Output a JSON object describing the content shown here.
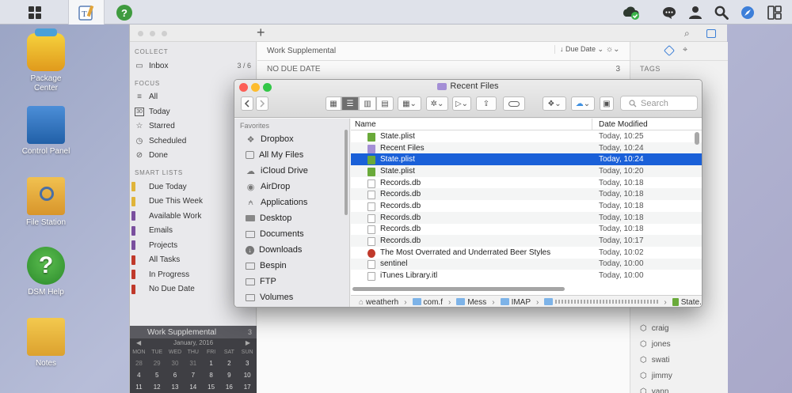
{
  "topbar": {
    "apps": [
      "grid-icon",
      "text-editor-icon",
      "help-icon"
    ],
    "right_icons": [
      "cloud-sync-icon",
      "chat-icon",
      "user-icon",
      "search-icon",
      "compass-icon",
      "widgets-icon"
    ]
  },
  "desktop": {
    "icons": [
      {
        "label_line1": "Package",
        "label_line2": "Center",
        "icon": "package-center-icon"
      },
      {
        "label_line1": "Control Panel",
        "label_line2": "",
        "icon": "control-panel-icon"
      },
      {
        "label_line1": "File Station",
        "label_line2": "",
        "icon": "file-station-icon"
      },
      {
        "label_line1": "DSM Help",
        "label_line2": "",
        "icon": "dsm-help-icon"
      },
      {
        "label_line1": "Notes",
        "label_line2": "",
        "icon": "notes-icon"
      }
    ]
  },
  "todo_app": {
    "sections": {
      "collect": "COLLECT",
      "focus": "FOCUS",
      "smart_lists": "SMART LISTS"
    },
    "inbox": {
      "label": "Inbox",
      "count": "3 / 6"
    },
    "focus_items": [
      {
        "label": "All",
        "icon": "stack-icon"
      },
      {
        "label": "Today",
        "icon": "calendar-30-icon"
      },
      {
        "label": "Starred",
        "icon": "star-icon"
      },
      {
        "label": "Scheduled",
        "icon": "clock-icon"
      },
      {
        "label": "Done",
        "icon": "checkmark-icon"
      }
    ],
    "smart_lists": [
      {
        "label": "Due Today",
        "color": "#e0b43a"
      },
      {
        "label": "Due This Week",
        "color": "#e0b43a"
      },
      {
        "label": "Available Work",
        "color": "#7a4f9e"
      },
      {
        "label": "Emails",
        "color": "#7a4f9e"
      },
      {
        "label": "Projects",
        "color": "#7a4f9e"
      },
      {
        "label": "All Tasks",
        "color": "#c0392b"
      },
      {
        "label": "In Progress",
        "color": "#c0392b"
      },
      {
        "label": "No Due Date",
        "color": "#c0392b"
      }
    ],
    "selected_list": {
      "label": "Work Supplemental",
      "count": "3"
    },
    "calendar": {
      "month": "January, 2016",
      "days_of_week": [
        "MON",
        "TUE",
        "WED",
        "THU",
        "FRI",
        "SAT",
        "SUN"
      ],
      "weeks": [
        [
          "28",
          "29",
          "30",
          "31",
          "1",
          "2",
          "3"
        ],
        [
          "4",
          "5",
          "6",
          "7",
          "8",
          "9",
          "10"
        ],
        [
          "11",
          "12",
          "13",
          "14",
          "15",
          "16",
          "17"
        ]
      ]
    },
    "list_title": "Work Supplemental",
    "sort_label": "Due Date",
    "group_header": {
      "label": "NO DUE DATE",
      "count": "3"
    },
    "tags_header": "TAGS",
    "tags": [
      "craig",
      "jones",
      "swati",
      "jimmy",
      "yann"
    ]
  },
  "finder": {
    "title": "Recent Files",
    "search_placeholder": "Search",
    "sidebar_header": "Favorites",
    "sidebar": [
      {
        "label": "Dropbox",
        "icon": "dropbox-icon"
      },
      {
        "label": "All My Files",
        "icon": "all-files-icon"
      },
      {
        "label": "iCloud Drive",
        "icon": "icloud-icon"
      },
      {
        "label": "AirDrop",
        "icon": "airdrop-icon"
      },
      {
        "label": "Applications",
        "icon": "applications-icon"
      },
      {
        "label": "Desktop",
        "icon": "desktop-icon"
      },
      {
        "label": "Documents",
        "icon": "documents-icon"
      },
      {
        "label": "Downloads",
        "icon": "downloads-icon"
      },
      {
        "label": "Bespin",
        "icon": "folder-icon"
      },
      {
        "label": "FTP",
        "icon": "folder-icon"
      },
      {
        "label": "Volumes",
        "icon": "folder-icon"
      }
    ],
    "columns": {
      "name": "Name",
      "date": "Date Modified"
    },
    "files": [
      {
        "name": "State.plist",
        "date": "Today, 10:25",
        "icon": "plist-file-icon",
        "color": "#6aaa3a"
      },
      {
        "name": "Recent Files",
        "date": "Today, 10:24",
        "icon": "smart-folder-icon",
        "color": "#a48fd6"
      },
      {
        "name": "State.plist",
        "date": "Today, 10:24",
        "icon": "plist-file-icon",
        "color": "#6aaa3a"
      },
      {
        "name": "State.plist",
        "date": "Today, 10:20",
        "icon": "plist-file-icon",
        "color": "#6aaa3a"
      },
      {
        "name": "Records.db",
        "date": "Today, 10:18",
        "icon": "document-icon",
        "color": "#ffffff"
      },
      {
        "name": "Records.db",
        "date": "Today, 10:18",
        "icon": "document-icon",
        "color": "#ffffff"
      },
      {
        "name": "Records.db",
        "date": "Today, 10:18",
        "icon": "document-icon",
        "color": "#ffffff"
      },
      {
        "name": "Records.db",
        "date": "Today, 10:18",
        "icon": "document-icon",
        "color": "#ffffff"
      },
      {
        "name": "Records.db",
        "date": "Today, 10:18",
        "icon": "document-icon",
        "color": "#ffffff"
      },
      {
        "name": "Records.db",
        "date": "Today, 10:17",
        "icon": "document-icon",
        "color": "#ffffff"
      },
      {
        "name": "The Most Overrated and Underrated Beer Styles",
        "date": "Today, 10:02",
        "icon": "web-archive-icon",
        "color": "#c0392b"
      },
      {
        "name": "sentinel",
        "date": "Today, 10:00",
        "icon": "document-icon",
        "color": "#ffffff"
      },
      {
        "name": "iTunes Library.itl",
        "date": "Today, 10:00",
        "icon": "document-icon",
        "color": "#ffffff"
      }
    ],
    "selected_index": 2,
    "path": [
      "weatherh",
      "com.f",
      "Mess",
      "IMAP",
      "State.plist"
    ],
    "colors": {
      "selection": "#1a60d8",
      "close": "#fc5f57",
      "minimize": "#fdbc2e",
      "zoom": "#33c748"
    }
  }
}
